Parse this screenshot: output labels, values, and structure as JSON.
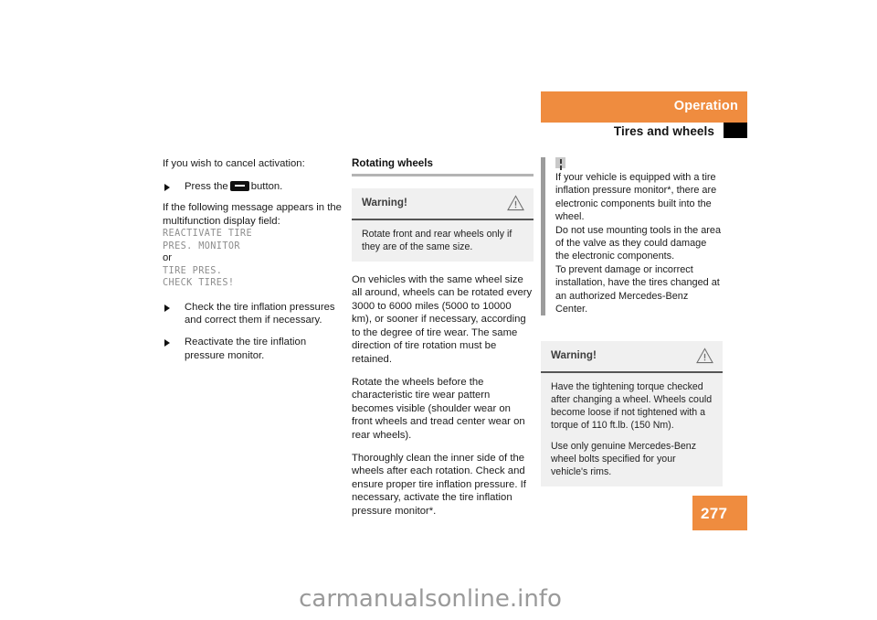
{
  "header": {
    "chapter": "Operation",
    "section": "Tires and wheels",
    "thumb_tab_icon": "thumb-tab-marker"
  },
  "page": {
    "number": "277",
    "accent_color": "#ef8c3f",
    "warning_box_bg": "#f0f0f0",
    "note_bar_color": "#9c9c9c"
  },
  "watermark": {
    "text": "carmanualsonline.info"
  },
  "column_left": {
    "intro": "If you wish to cancel activation:",
    "step_press": {
      "before": "Press the",
      "button_icon": "minus-button",
      "after": "button."
    },
    "message_intro": "If the following message appears in the multifunction display field:",
    "display_message_1": "REACTIVATE TIRE\nPRES. MONITOR",
    "or_label": "or",
    "display_message_2": "TIRE PRES.\nCHECK TIRES!",
    "steps": [
      "Check the tire inflation pressures and correct them if necessary.",
      "Reactivate the tire inflation pressure monitor."
    ]
  },
  "column_middle": {
    "heading": "Rotating wheels",
    "warning": {
      "label": "Warning!",
      "icon": "warning-triangle-icon",
      "paragraphs": [
        "Rotate front and rear wheels only if they are of the same size."
      ]
    },
    "paragraphs": [
      "On vehicles with the same wheel size all around, wheels can be rotated every 3000 to 6000 miles (5000 to 10000 km), or sooner if necessary, according to the degree of tire wear. The same direction of tire rotation must be retained.",
      "Rotate the wheels before the characteristic tire wear pattern becomes visible (shoulder wear on front wheels and tread center wear on rear wheels).",
      "Thoroughly clean the inner side of the wheels after each rotation. Check and ensure proper tire inflation pressure. If necessary, activate the tire inflation pressure monitor*."
    ]
  },
  "column_right": {
    "note": {
      "icon": "exclamation-note-icon",
      "paragraphs": [
        "If your vehicle is equipped with a tire inflation pressure monitor*, there are electronic components built into the wheel.",
        "Do not use mounting tools in the area of the valve as they could damage the electronic components.",
        "To prevent damage or incorrect installation, have the tires changed at an authorized Mercedes-Benz Center."
      ]
    },
    "warning": {
      "label": "Warning!",
      "icon": "warning-triangle-icon",
      "paragraphs": [
        "Have the tightening torque checked after changing a wheel. Wheels could become loose if not tightened with a torque of 110 ft.lb. (150 Nm).",
        "Use only genuine Mercedes-Benz wheel bolts specified for your vehicle's rims."
      ]
    }
  }
}
